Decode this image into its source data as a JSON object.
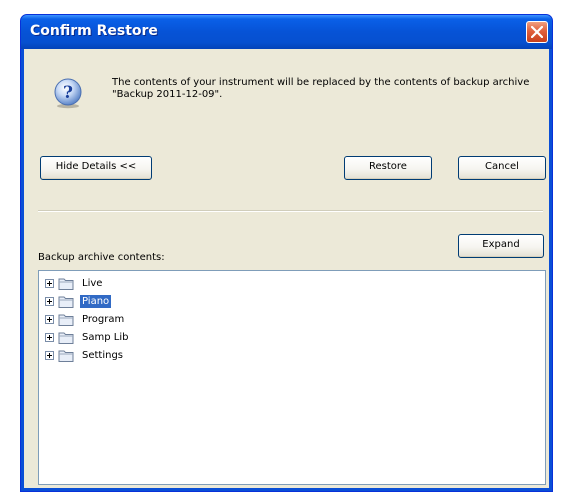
{
  "window": {
    "title": "Confirm Restore"
  },
  "message": {
    "text": "The contents of your instrument will be replaced by the contents of backup archive \"Backup 2011-12-09\"."
  },
  "buttons": {
    "hide_details": "Hide Details <<",
    "restore": "Restore",
    "cancel": "Cancel",
    "expand": "Expand"
  },
  "contents": {
    "label": "Backup archive contents:",
    "items": [
      {
        "label": "Live",
        "selected": false
      },
      {
        "label": "Piano",
        "selected": true
      },
      {
        "label": "Program",
        "selected": false
      },
      {
        "label": "Samp Lib",
        "selected": false
      },
      {
        "label": "Settings",
        "selected": false
      }
    ]
  },
  "icons": {
    "title_close": "close-icon",
    "message": "question-icon",
    "expander": "plus-box-icon",
    "folder": "folder-icon"
  },
  "colors": {
    "titlebar": "#0653d6",
    "dialog_bg": "#ece9d8",
    "selection": "#316ac5",
    "close_button": "#e0603c"
  }
}
